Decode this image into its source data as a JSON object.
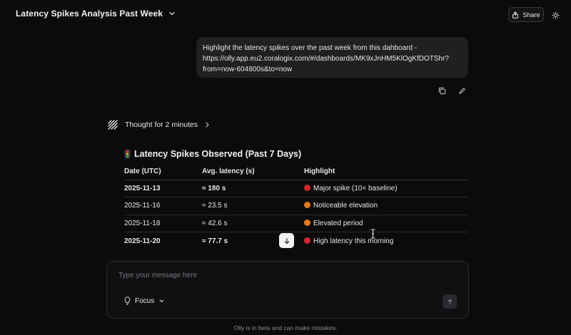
{
  "header": {
    "title": "Latency Spikes Analysis Past Week",
    "share_label": "Share"
  },
  "user_message": {
    "lines": [
      "Highlight the latency spikes over the past week from this dahboard -",
      "https://olly.app.eu2.coralogix.com/#/dashboards/MK9xJnHM5KlOgKfDOTShr?",
      "from=now-604800s&to=now"
    ]
  },
  "thought": {
    "label": "Thought for 2 minutes"
  },
  "answer": {
    "title": "Latency Spikes Observed (Past 7 Days)",
    "columns": [
      "Date (UTC)",
      "Avg. latency (s)",
      "Highlight"
    ],
    "rows": [
      {
        "date": "2025-11-13",
        "latency": "≈ 180 s",
        "highlight": "Major spike (10× baseline)",
        "severity": "red",
        "bold": true
      },
      {
        "date": "2025-11-16",
        "latency": "≈ 23.5 s",
        "highlight": "Noticeable elevation",
        "severity": "orange",
        "bold": false
      },
      {
        "date": "2025-11-18",
        "latency": "≈ 42.6 s",
        "highlight": "Elevated period",
        "severity": "orange",
        "bold": false
      },
      {
        "date": "2025-11-20",
        "latency": "≈ 77.7 s",
        "highlight": "High latency this morning",
        "severity": "red",
        "bold": true
      }
    ]
  },
  "composer": {
    "placeholder": "Type your message here",
    "focus_label": "Focus"
  },
  "footer": {
    "note": "Olly is in beta and can make mistakes."
  },
  "colors": {
    "background": "#0b0b0c",
    "severity_red": "#d7262b",
    "severity_orange": "#e8791a"
  },
  "icons": {
    "title_chevron": "chevron-down-icon",
    "share": "share-icon",
    "theme": "sun-icon",
    "copy": "copy-icon",
    "edit": "pencil-icon",
    "thought": "thought-icon",
    "thought_chevron": "chevron-right-icon",
    "title_emoji": "traffic-light-icon",
    "scroll": "arrow-down-icon",
    "focus": "lightbulb-icon",
    "focus_chevron": "chevron-down-icon",
    "send": "arrow-up-icon"
  }
}
